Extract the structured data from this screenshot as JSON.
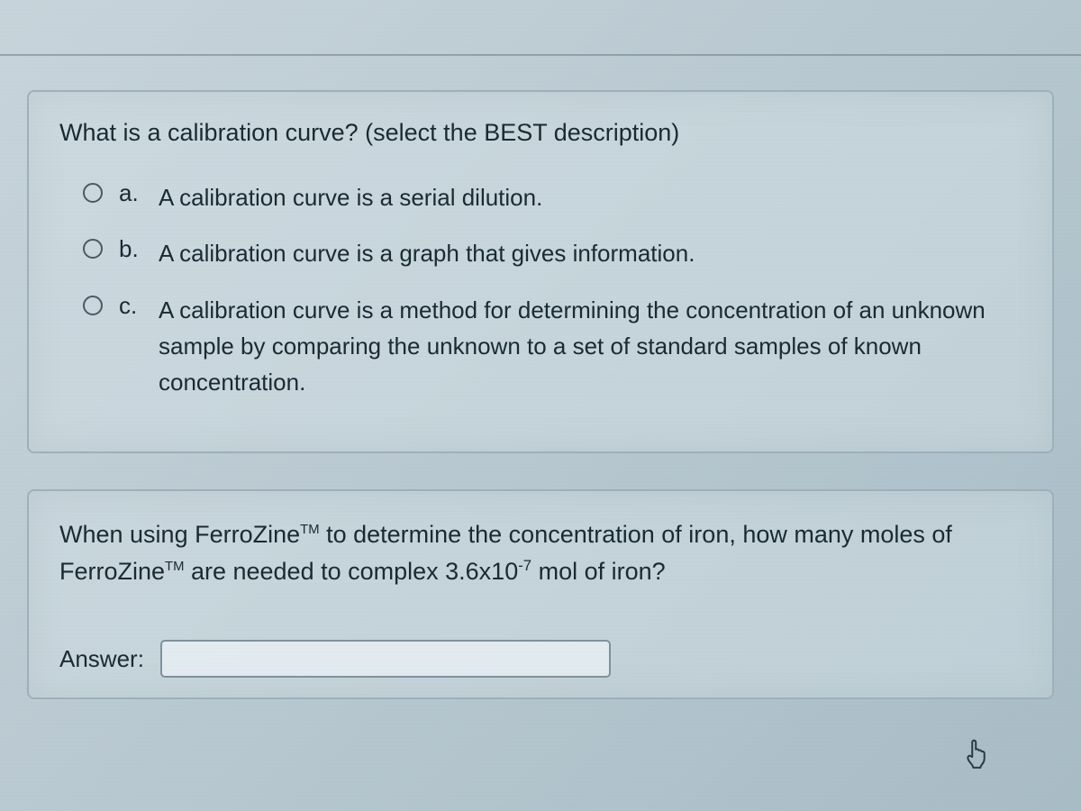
{
  "q1": {
    "prompt": "What is a calibration curve?  (select the BEST description)",
    "options": [
      {
        "letter": "a.",
        "text": "A calibration curve is a serial dilution."
      },
      {
        "letter": "b.",
        "text": "A calibration curve is a graph that gives information."
      },
      {
        "letter": "c.",
        "text": "A calibration curve is a method for determining the concentration of an unknown sample by comparing the unknown to a set of standard samples of known concentration."
      }
    ]
  },
  "q2": {
    "prefix1": "When using FerroZine",
    "tm": "TM",
    "mid1": " to determine the concentration of iron, how many moles of FerroZine",
    "mid2": " are needed to complex 3.6x10",
    "exp": "-7",
    "suffix": " mol of iron?",
    "answer_label": "Answer:",
    "answer_value": ""
  }
}
